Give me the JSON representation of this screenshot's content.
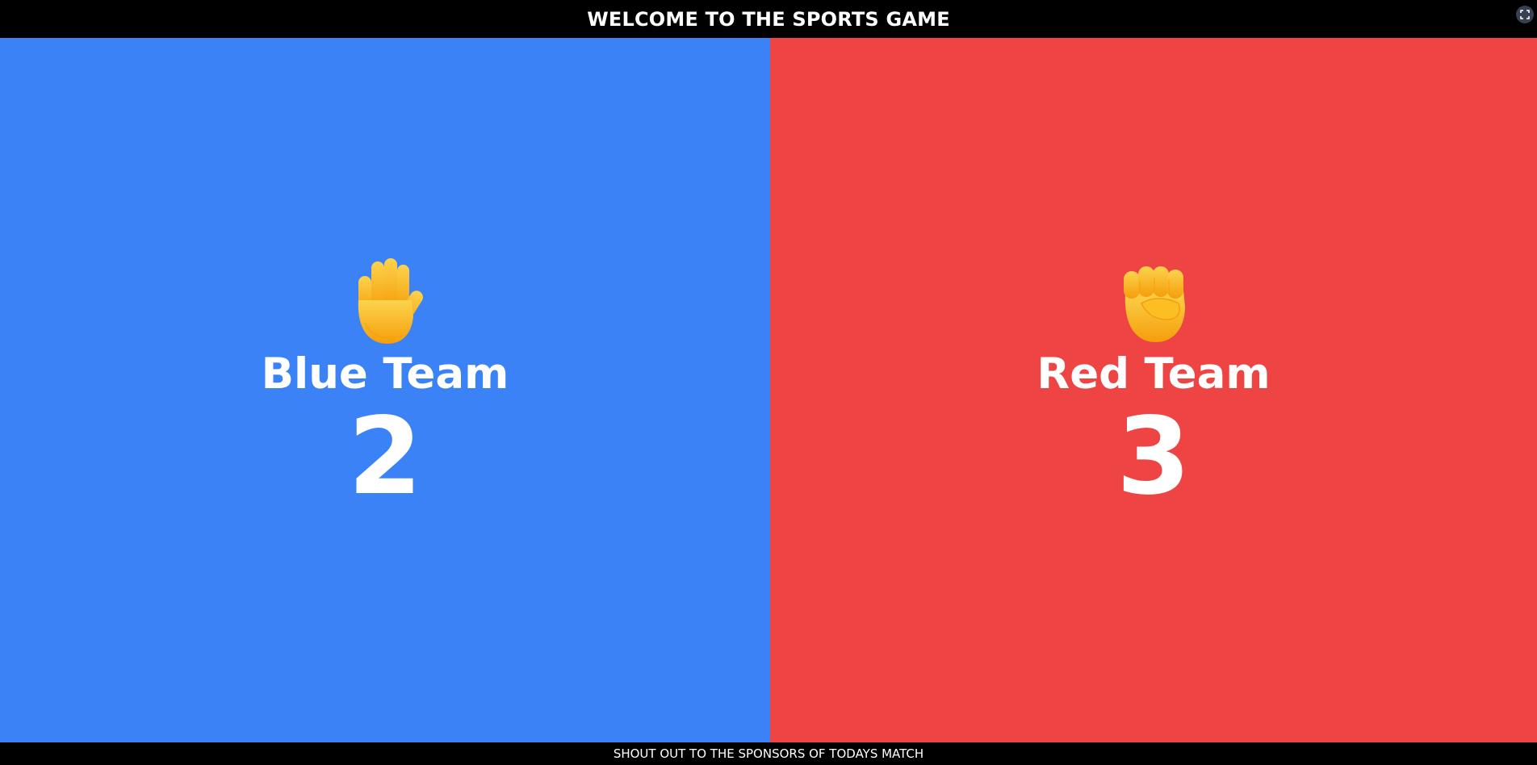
{
  "header": {
    "title": "WELCOME TO THE SPORTS GAME",
    "fullscreen_icon": "fullscreen-icon"
  },
  "teams": [
    {
      "name": "Blue Team",
      "score": "2",
      "icon": "raised-hand-icon",
      "color": "#3b82f6"
    },
    {
      "name": "Red Team",
      "score": "3",
      "icon": "raised-fist-icon",
      "color": "#ef4444"
    }
  ],
  "footer": {
    "text": "SHOUT OUT TO THE SPONSORS OF TODAYS MATCH"
  },
  "colors": {
    "bar_background": "#000000",
    "text": "#ffffff",
    "emoji_yellow": "#fbbf24"
  }
}
